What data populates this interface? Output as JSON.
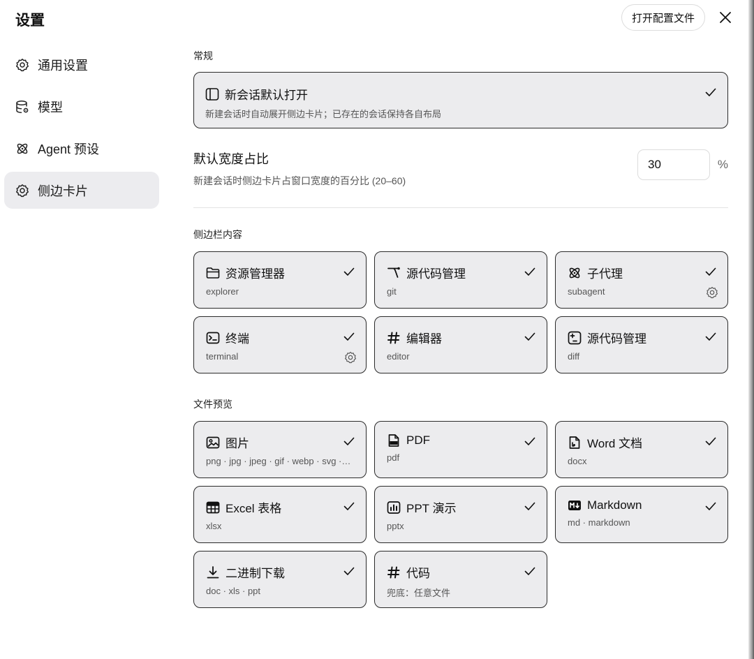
{
  "page": {
    "title": "设置",
    "open_config_label": "打开配置文件"
  },
  "sidebar": {
    "items": [
      {
        "label": "通用设置",
        "icon": "gear-icon",
        "active": false
      },
      {
        "label": "模型",
        "icon": "database-gear-icon",
        "active": false
      },
      {
        "label": "Agent 预设",
        "icon": "atom-icon",
        "active": false
      },
      {
        "label": "侧边卡片",
        "icon": "gear-icon",
        "active": true
      }
    ]
  },
  "general": {
    "section_title": "常规",
    "new_session": {
      "title": "新会话默认打开",
      "desc": "新建会话时自动展开侧边卡片；已存在的会话保持各自布局",
      "checked": true,
      "icon": "sidebar-panel-icon"
    },
    "default_width": {
      "label": "默认宽度占比",
      "desc": "新建会话时侧边卡片占窗口宽度的百分比 (20–60)",
      "value": "30",
      "unit": "%"
    }
  },
  "sidebar_content": {
    "section_title": "侧边栏内容",
    "cards": [
      {
        "title": "资源管理器",
        "sub": "explorer",
        "icon": "folder-icon",
        "checked": true,
        "has_settings": false
      },
      {
        "title": "源代码管理",
        "sub": "git",
        "icon": "git-branch-icon",
        "checked": true,
        "has_settings": false
      },
      {
        "title": "子代理",
        "sub": "subagent",
        "icon": "atom-icon",
        "checked": true,
        "has_settings": true
      },
      {
        "title": "终端",
        "sub": "terminal",
        "icon": "terminal-icon",
        "checked": true,
        "has_settings": true
      },
      {
        "title": "编辑器",
        "sub": "editor",
        "icon": "hash-icon",
        "checked": true,
        "has_settings": false
      },
      {
        "title": "源代码管理",
        "sub": "diff",
        "icon": "diff-icon",
        "checked": true,
        "has_settings": false
      }
    ]
  },
  "file_preview": {
    "section_title": "文件预览",
    "cards": [
      {
        "title": "图片",
        "sub": "png · jpg · jpeg · gif · webp · svg · bmp · ico",
        "icon": "image-icon",
        "checked": true
      },
      {
        "title": "PDF",
        "sub": "pdf",
        "icon": "pdf-file-icon",
        "checked": true
      },
      {
        "title": "Word 文档",
        "sub": "docx",
        "icon": "word-file-icon",
        "checked": true
      },
      {
        "title": "Excel 表格",
        "sub": "xlsx",
        "icon": "table-icon",
        "checked": true
      },
      {
        "title": "PPT 演示",
        "sub": "pptx",
        "icon": "presentation-chart-icon",
        "checked": true
      },
      {
        "title": "Markdown",
        "sub": "md · markdown",
        "icon": "markdown-icon",
        "checked": true
      },
      {
        "title": "二进制下载",
        "sub": "doc · xls · ppt",
        "icon": "download-icon",
        "checked": true
      },
      {
        "title": "代码",
        "sub": "兜底：任意文件",
        "icon": "hash-icon",
        "checked": true
      }
    ]
  }
}
